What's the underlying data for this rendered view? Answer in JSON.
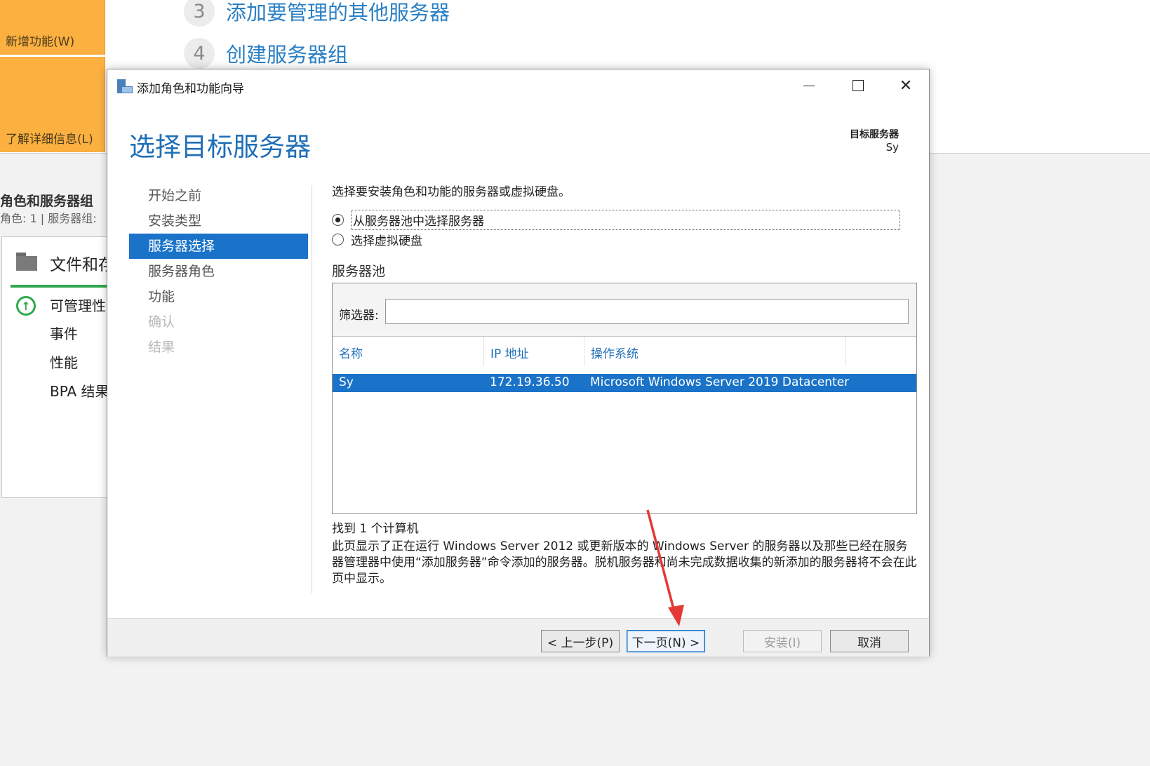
{
  "background": {
    "tiles": [
      "新增功能(W)",
      "了解详细信息(L)"
    ],
    "steps": [
      {
        "num": "3",
        "label": "添加要管理的其他服务器"
      },
      {
        "num": "4",
        "label": "创建服务器组"
      }
    ],
    "roles_title": "角色和服务器组",
    "roles_sub": "角色: 1 | 服务器组:",
    "panel": {
      "title": "文件和存",
      "rows": [
        "可管理性",
        "事件",
        "性能",
        "BPA 结果"
      ]
    }
  },
  "dialog": {
    "title": "添加角色和功能向导",
    "heading": "选择目标服务器",
    "dest_label": "目标服务器",
    "dest_value": "Sy",
    "nav": [
      "开始之前",
      "安装类型",
      "服务器选择",
      "服务器角色",
      "功能",
      "确认",
      "结果"
    ],
    "instruction": "选择要安装角色和功能的服务器或虚拟硬盘。",
    "radio_pool": "从服务器池中选择服务器",
    "radio_vhd": "选择虚拟硬盘",
    "pool_label": "服务器池",
    "filter_label": "筛选器:",
    "filter_value": "",
    "columns": [
      "名称",
      "IP 地址",
      "操作系统"
    ],
    "rows": [
      {
        "name": "Sy",
        "ip": "172.19.36.50",
        "os": "Microsoft Windows Server 2019 Datacenter"
      }
    ],
    "found": "找到 1 个计算机",
    "description": "此页显示了正在运行 Windows Server 2012 或更新版本的 Windows Server 的服务器以及那些已经在服务器管理器中使用“添加服务器”命令添加的服务器。脱机服务器和尚未完成数据收集的新添加的服务器将不会在此页中显示。",
    "buttons": {
      "prev": "< 上一步(P)",
      "next": "下一页(N) >",
      "install": "安装(I)",
      "cancel": "取消"
    }
  },
  "colors": {
    "accent": "#1a73c8",
    "tile": "#fbb040",
    "annotation_arrow": "#e53935"
  },
  "icons": [
    "wizard-icon",
    "minimize-icon",
    "maximize-icon",
    "close-icon",
    "folder-icon",
    "manageability-up-icon",
    "annotation-arrow"
  ]
}
